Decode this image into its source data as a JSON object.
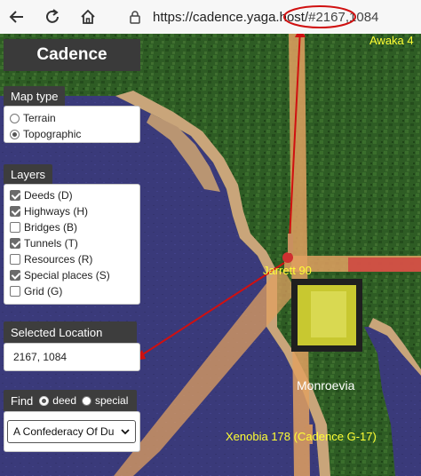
{
  "browser": {
    "url_prefix": "https://cadence.yaga.host/",
    "url_hash": "#2167,1084"
  },
  "app": {
    "title": "Cadence"
  },
  "map_type": {
    "title": "Map type",
    "options": [
      {
        "label": "Terrain",
        "selected": false
      },
      {
        "label": "Topographic",
        "selected": true
      }
    ]
  },
  "layers": {
    "title": "Layers",
    "items": [
      {
        "label": "Deeds (D)",
        "checked": true
      },
      {
        "label": "Highways (H)",
        "checked": true
      },
      {
        "label": "Bridges (B)",
        "checked": false
      },
      {
        "label": "Tunnels (T)",
        "checked": true
      },
      {
        "label": "Resources (R)",
        "checked": false
      },
      {
        "label": "Special places (S)",
        "checked": true
      },
      {
        "label": "Grid (G)",
        "checked": false
      }
    ]
  },
  "selected_location": {
    "title": "Selected Location",
    "value": "2167, 1084"
  },
  "find": {
    "label": "Find",
    "options": [
      {
        "label": "deed",
        "selected": true
      },
      {
        "label": "special",
        "selected": false
      }
    ],
    "select_value": "A Confederacy Of Du"
  },
  "map_labels": {
    "awaka": "Awaka 4",
    "jarrett": "Jarrett 90",
    "monroevia": "Monroevia",
    "xenobia": "Xenobia 178 (Cadence G-17)"
  },
  "colors": {
    "water": "#3a3a78",
    "land": "#2c5a22",
    "sand": "#c9a57a",
    "highway": "#e0a060",
    "annotation": "#d01010",
    "label": "#ffff33"
  },
  "icons": [
    "back-arrow-icon",
    "refresh-icon",
    "home-icon",
    "lock-icon",
    "chevron-down-icon"
  ]
}
